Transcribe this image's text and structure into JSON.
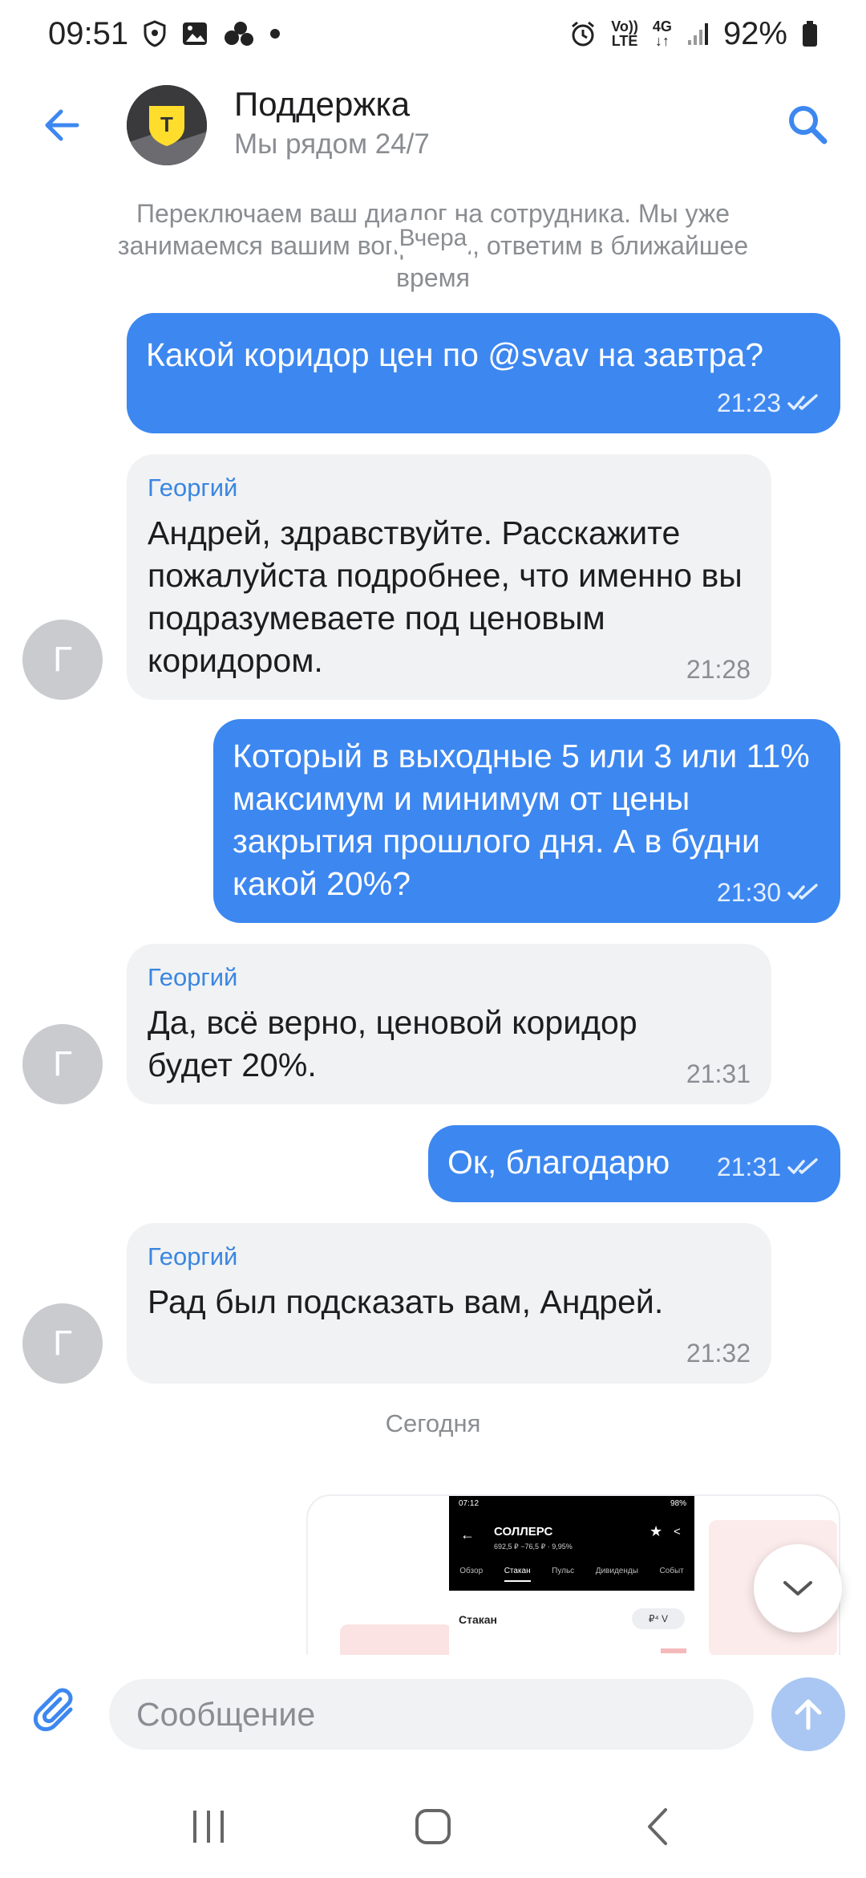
{
  "status_bar": {
    "time": "09:51",
    "network_top": "Vo))",
    "network_bottom": "LTE",
    "gen_top": "4G",
    "gen_bottom": "↓↑",
    "battery": "92%"
  },
  "header": {
    "title": "Поддержка",
    "subtitle": "Мы рядом 24/7",
    "logo_letter": "T"
  },
  "system_message": "Переключаем ваш диалог на сотрудника. Мы уже занимаемся вашим вопросом, ответим в ближайшее время",
  "date_yesterday": "Вчера",
  "messages": [
    {
      "direction": "out",
      "text": "Какой коридор цен по @svav на завтра?",
      "time": "21:23"
    },
    {
      "direction": "in",
      "sender": "Георгий",
      "text": "Андрей, здравствуйте. Расскажите пожалуйста подробнее, что именно вы подразумеваете под ценовым коридором.",
      "time": "21:28",
      "avatar": "Г"
    },
    {
      "direction": "out",
      "text": "Который в выходные 5 или 3 или 11% максимум и минимум от цены закрытия прошлого дня. А в будни какой 20%?",
      "time": "21:30"
    },
    {
      "direction": "in",
      "sender": "Георгий",
      "text": "Да, всё верно, ценовой коридор будет 20%.",
      "time": "21:31",
      "avatar": "Г"
    },
    {
      "direction": "out",
      "text": "Ок, благодарю",
      "time": "21:31"
    },
    {
      "direction": "in",
      "sender": "Георгий",
      "text": "Рад был подсказать вам, Андрей.",
      "time": "21:32",
      "avatar": "Г"
    }
  ],
  "date_today": "Сегодня",
  "image_preview": {
    "status_time": "07:12",
    "status_battery": "98%",
    "title": "СОЛЛЕРС",
    "subtitle": "692,5 ₽ −76,5 ₽ · 9,95%",
    "tabs": [
      "Обзор",
      "Стакан",
      "Пульс",
      "Дивиденды",
      "Событ"
    ],
    "active_tab": "Стакан",
    "section": "Стакан",
    "toggle": "₽⁴  V"
  },
  "input": {
    "placeholder": "Сообщение"
  },
  "colors": {
    "accent": "#3d87f0",
    "incoming_bubble": "#f1f2f4",
    "sender_name": "#3a86e0",
    "send_button_disabled": "#a9c7f2"
  },
  "icons": {
    "back": "arrow-left-icon",
    "search": "search-icon",
    "attach": "paperclip-icon",
    "send": "arrow-up-icon",
    "scroll_down": "chevron-down-icon",
    "read": "double-check-icon"
  }
}
